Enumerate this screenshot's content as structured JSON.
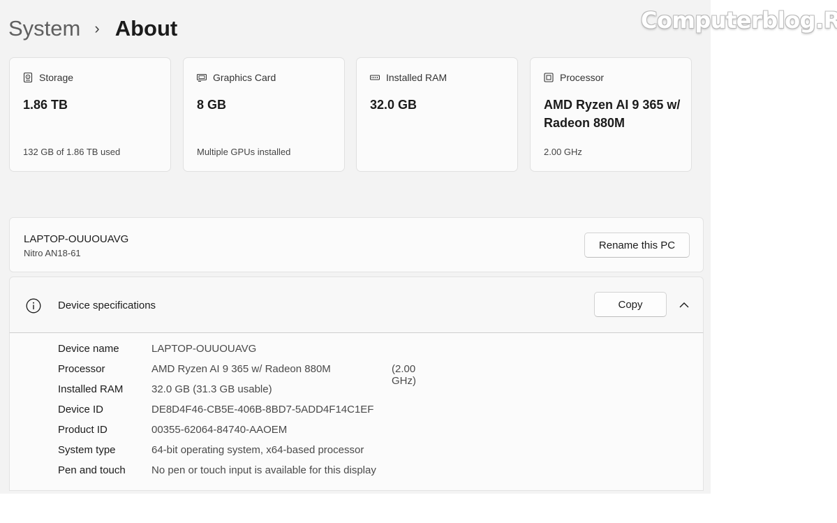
{
  "watermark": "Computerblog.Ro",
  "breadcrumb": {
    "parent": "System",
    "separator": "›",
    "current": "About"
  },
  "cards": [
    {
      "icon": "storage-icon",
      "label": "Storage",
      "value": "1.86 TB",
      "sub": "132 GB of 1.86 TB used"
    },
    {
      "icon": "graphics-card-icon",
      "label": "Graphics Card",
      "value": "8 GB",
      "sub": "Multiple GPUs installed"
    },
    {
      "icon": "ram-icon",
      "label": "Installed RAM",
      "value": "32.0 GB",
      "sub": ""
    },
    {
      "icon": "processor-icon",
      "label": "Processor",
      "value": "AMD Ryzen AI 9 365 w/ Radeon 880M",
      "sub": "2.00 GHz"
    }
  ],
  "pc": {
    "name": "LAPTOP-OUUOUAVG",
    "model": "Nitro AN18-61",
    "rename_label": "Rename this PC"
  },
  "specs": {
    "title": "Device specifications",
    "copy_label": "Copy",
    "rows": [
      {
        "key": "Device name",
        "value": "LAPTOP-OUUOUAVG",
        "extra": ""
      },
      {
        "key": "Processor",
        "value": "AMD Ryzen AI 9 365 w/ Radeon 880M",
        "extra": "(2.00 GHz)"
      },
      {
        "key": "Installed RAM",
        "value": "32.0 GB (31.3 GB usable)",
        "extra": ""
      },
      {
        "key": "Device ID",
        "value": "DE8D4F46-CB5E-406B-8BD7-5ADD4F14C1EF",
        "extra": ""
      },
      {
        "key": "Product ID",
        "value": "00355-62064-84740-AAOEM",
        "extra": ""
      },
      {
        "key": "System type",
        "value": "64-bit operating system, x64-based processor",
        "extra": ""
      },
      {
        "key": "Pen and touch",
        "value": "No pen or touch input is available for this display",
        "extra": ""
      }
    ]
  }
}
